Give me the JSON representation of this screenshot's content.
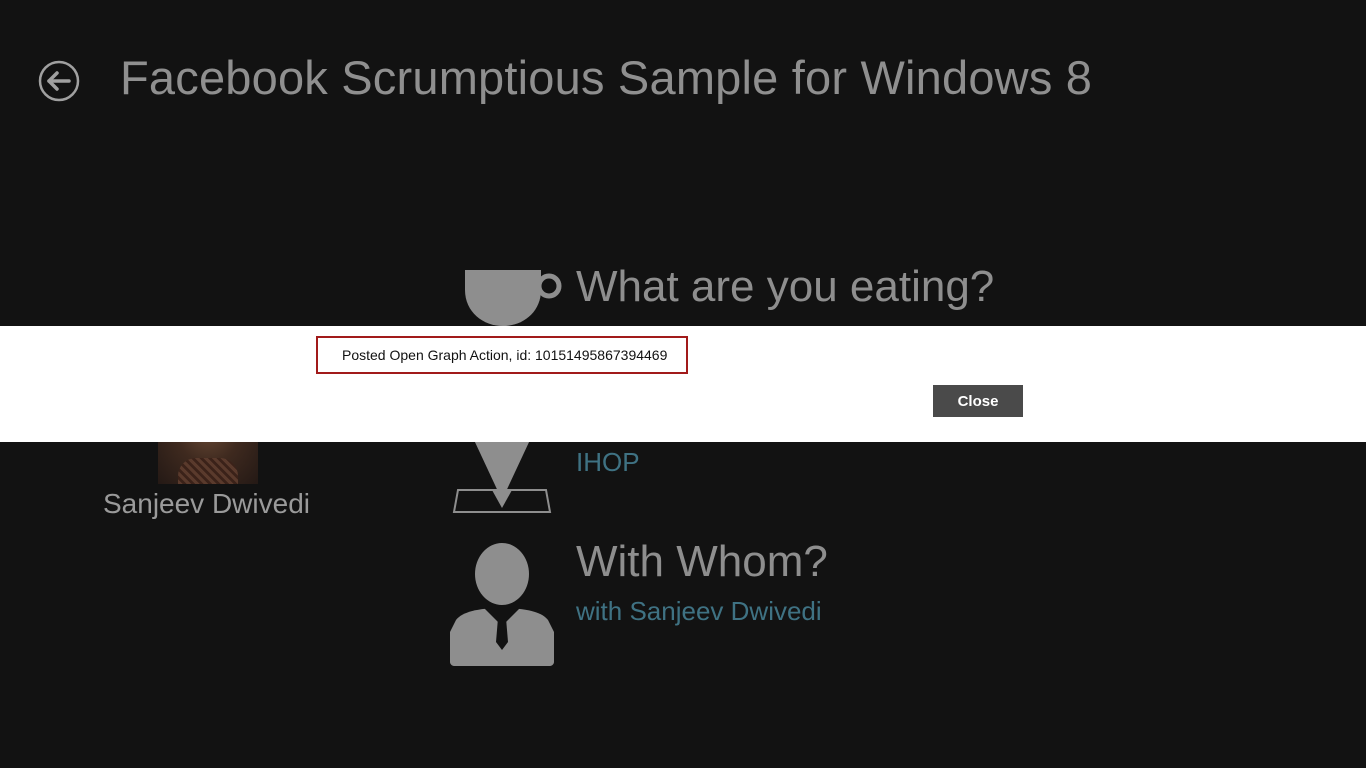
{
  "app": {
    "title": "Facebook Scrumptious Sample for Windows 8",
    "back_icon": "back-arrow-icon"
  },
  "profile": {
    "name": "Sanjeev Dwivedi"
  },
  "sections": {
    "eating": {
      "title": "What are you eating?",
      "icon": "coffee-cup-icon"
    },
    "location": {
      "value": "IHOP",
      "icon": "location-pin-icon"
    },
    "friends": {
      "title": "With Whom?",
      "value": "with Sanjeev Dwivedi",
      "icon": "person-icon"
    }
  },
  "dialog": {
    "message": "Posted Open Graph Action, id: 10151495867394469",
    "close_label": "Close"
  },
  "colors": {
    "background": "#121212",
    "accent_text": "#3f7283",
    "dialog_border": "#a11a1a",
    "button_bg": "#4a4a4a"
  }
}
